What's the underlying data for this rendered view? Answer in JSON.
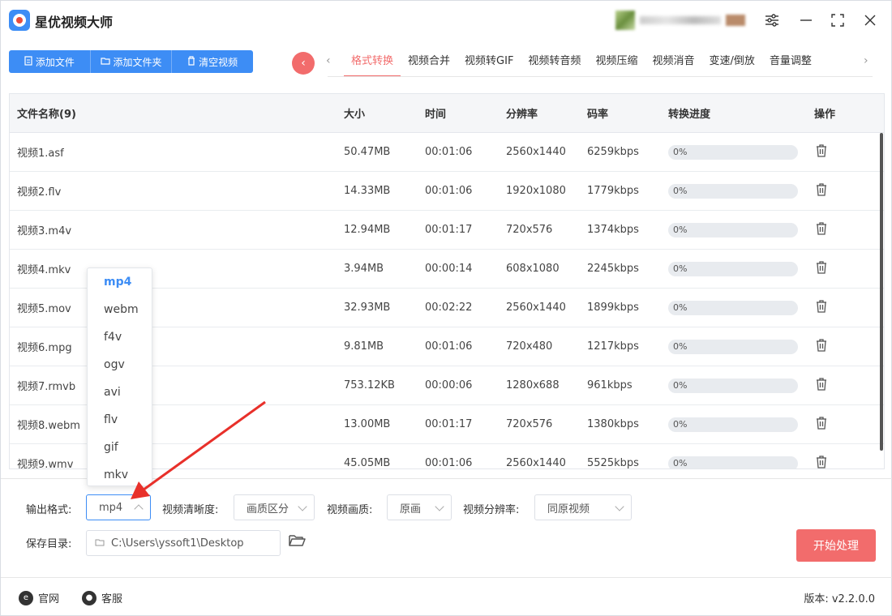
{
  "app": {
    "title": "星优视频大师"
  },
  "toolbar": {
    "add_file": "添加文件",
    "add_folder": "添加文件夹",
    "clear": "清空视频"
  },
  "tabs": [
    "格式转换",
    "视频合并",
    "视频转GIF",
    "视频转音频",
    "视频压缩",
    "视频消音",
    "变速/倒放",
    "音量调整"
  ],
  "table": {
    "headers": [
      "文件名称(9)",
      "大小",
      "时间",
      "分辨率",
      "码率",
      "转换进度",
      "操作"
    ],
    "rows": [
      {
        "name": "视频1.asf",
        "size": "50.47MB",
        "time": "00:01:06",
        "res": "2560x1440",
        "bitrate": "6259kbps",
        "progress": "0%"
      },
      {
        "name": "视频2.flv",
        "size": "14.33MB",
        "time": "00:01:06",
        "res": "1920x1080",
        "bitrate": "1779kbps",
        "progress": "0%"
      },
      {
        "name": "视频3.m4v",
        "size": "12.94MB",
        "time": "00:01:17",
        "res": "720x576",
        "bitrate": "1374kbps",
        "progress": "0%"
      },
      {
        "name": "视频4.mkv",
        "size": "3.94MB",
        "time": "00:00:14",
        "res": "608x1080",
        "bitrate": "2245kbps",
        "progress": "0%"
      },
      {
        "name": "视频5.mov",
        "size": "32.93MB",
        "time": "00:02:22",
        "res": "2560x1440",
        "bitrate": "1899kbps",
        "progress": "0%"
      },
      {
        "name": "视频6.mpg",
        "size": "9.81MB",
        "time": "00:01:06",
        "res": "720x480",
        "bitrate": "1217kbps",
        "progress": "0%"
      },
      {
        "name": "视频7.rmvb",
        "size": "753.12KB",
        "time": "00:00:06",
        "res": "1280x688",
        "bitrate": "961kbps",
        "progress": "0%"
      },
      {
        "name": "视频8.webm",
        "size": "13.00MB",
        "time": "00:01:17",
        "res": "720x576",
        "bitrate": "1380kbps",
        "progress": "0%"
      },
      {
        "name": "视频9.wmv",
        "size": "45.05MB",
        "time": "00:01:06",
        "res": "2560x1440",
        "bitrate": "5525kbps",
        "progress": "0%"
      }
    ]
  },
  "format_dropdown": {
    "options": [
      "mp4",
      "webm",
      "f4v",
      "ogv",
      "avi",
      "flv",
      "gif",
      "mkv"
    ],
    "selected": "mp4"
  },
  "settings": {
    "output_format_label": "输出格式:",
    "output_format_value": "mp4",
    "clarity_label": "视频清晰度:",
    "clarity_value": "画质区分",
    "quality_label": "视频画质:",
    "quality_value": "原画",
    "resolution_label": "视频分辨率:",
    "resolution_value": "同原视频",
    "save_dir_label": "保存目录:",
    "save_dir_value": "C:\\Users\\yssoft1\\Desktop",
    "start_label": "开始处理"
  },
  "footer": {
    "website": "官网",
    "support": "客服",
    "version": "版本: v2.2.0.0"
  },
  "colors": {
    "accent_blue": "#3d8df5",
    "accent_red": "#f26c6c"
  }
}
